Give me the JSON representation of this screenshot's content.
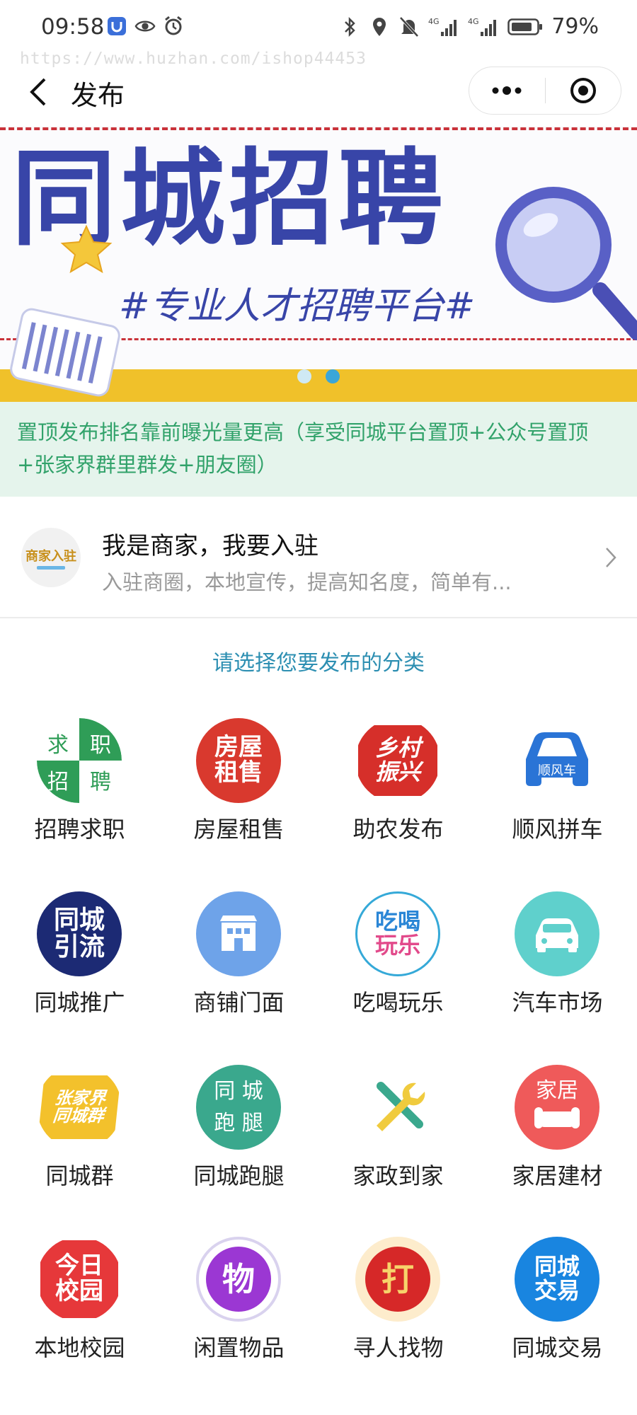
{
  "status_bar": {
    "time": "09:58",
    "battery": "79%",
    "icons": [
      "shield-app-icon",
      "eye-icon",
      "alarm-icon",
      "bluetooth-icon",
      "location-icon",
      "mute-icon",
      "signal-4g-icon",
      "signal-4g-icon",
      "battery-icon"
    ]
  },
  "watermark": "https://www.huzhan.com/ishop44453",
  "nav": {
    "title": "发布",
    "back_icon": "chevron-left-icon",
    "more_icon": "more-dots-icon",
    "close_icon": "target-circle-icon"
  },
  "banner": {
    "title": "同城招聘",
    "subtitle": "#专业人才招聘平台#",
    "colors": {
      "title": "#3845a8",
      "dash": "#c9323a",
      "band": "#f0c12a"
    },
    "active_slide": 2,
    "slide_count": 2
  },
  "notice": {
    "text": "置顶发布排名靠前曝光量更高（享受同城平台置顶+公众号置顶+张家界群里群发+朋友圈）",
    "colors": {
      "bg": "#e5f4ec",
      "text": "#31a26a"
    }
  },
  "merchant": {
    "avatar_text": "商家入驻",
    "title": "我是商家，我要入驻",
    "description": "入驻商圈，本地宣传，提高知名度，简单有..."
  },
  "section_title": "请选择您要发布的分类",
  "categories": [
    {
      "label": "招聘求职",
      "icon": "recruit-icon",
      "glyphs": [
        "求",
        "职",
        "招",
        "聘"
      ]
    },
    {
      "label": "房屋租售",
      "icon": "house-rent-icon",
      "glyphs": [
        "房屋",
        "租售"
      ]
    },
    {
      "label": "助农发布",
      "icon": "rural-revival-icon",
      "glyphs": [
        "乡村",
        "振兴"
      ]
    },
    {
      "label": "顺风拼车",
      "icon": "carpool-icon",
      "glyphs": [
        "顺风车"
      ]
    },
    {
      "label": "同城推广",
      "icon": "promo-icon",
      "glyphs": [
        "同城",
        "引流"
      ]
    },
    {
      "label": "商铺门面",
      "icon": "shop-icon",
      "glyphs": []
    },
    {
      "label": "吃喝玩乐",
      "icon": "food-fun-icon",
      "glyphs": [
        "吃喝",
        "玩乐"
      ]
    },
    {
      "label": "汽车市场",
      "icon": "car-market-icon",
      "glyphs": []
    },
    {
      "label": "同城群",
      "icon": "group-icon",
      "glyphs": [
        "张家界",
        "同城群"
      ]
    },
    {
      "label": "同城跑腿",
      "icon": "errand-icon",
      "glyphs": [
        "同 城",
        "跑 腿"
      ]
    },
    {
      "label": "家政到家",
      "icon": "tools-icon",
      "glyphs": []
    },
    {
      "label": "家居建材",
      "icon": "home-deco-icon",
      "glyphs": [
        "家居"
      ]
    },
    {
      "label": "本地校园",
      "icon": "campus-icon",
      "glyphs": [
        "今日",
        "校园"
      ]
    },
    {
      "label": "闲置物品",
      "icon": "idle-goods-icon",
      "glyphs": [
        "物"
      ]
    },
    {
      "label": "寻人找物",
      "icon": "lost-found-icon",
      "glyphs": [
        "打"
      ]
    },
    {
      "label": "同城交易",
      "icon": "trade-icon",
      "glyphs": [
        "同城",
        "交易"
      ]
    }
  ]
}
